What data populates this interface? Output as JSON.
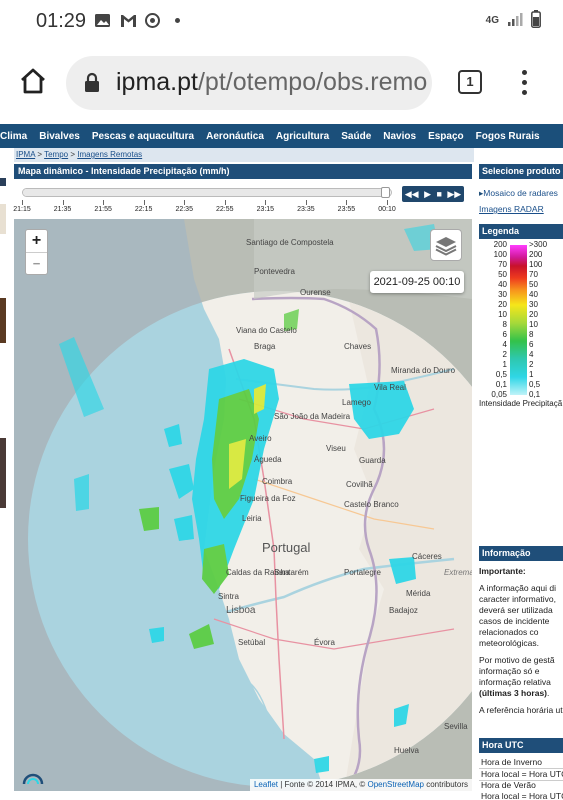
{
  "status_bar": {
    "time": "01:29",
    "network": "4G"
  },
  "browser": {
    "url_host": "ipma.pt",
    "url_path": "/pt/otempo/obs.remo",
    "tab_count": "1"
  },
  "nav": {
    "items": [
      "Clima",
      "Bivalves",
      "Pescas e aquacultura",
      "Aeronáutica",
      "Agricultura",
      "Saúde",
      "Navios",
      "Espaço",
      "Fogos Rurais"
    ]
  },
  "breadcrumb": {
    "items": [
      "IPMA",
      "Tempo",
      "Imagens Remotas"
    ],
    "sep": " > "
  },
  "panel": {
    "title": "Mapa dinâmico - Intensidade Precipitação (mm/h)"
  },
  "timeline": {
    "labels": [
      "21:15",
      "21:35",
      "21:55",
      "22:15",
      "22:35",
      "22:55",
      "23:15",
      "23:35",
      "23:55",
      "00:10"
    ],
    "progress": 1.0,
    "controls": [
      "◀◀",
      "▶",
      "■",
      "▶▶"
    ]
  },
  "map": {
    "zoom_in": "+",
    "zoom_out": "−",
    "timestamp": "2021-09-25 00:10",
    "attribution_leaflet": "Leaflet",
    "attribution_mid": " | Fonte © 2014 IPMA, © ",
    "attribution_osm": "OpenStreetMap",
    "attribution_end": " contributors",
    "places": [
      {
        "name": "Santiago de Compostela"
      },
      {
        "name": "Pontevedra"
      },
      {
        "name": "Ourense"
      },
      {
        "name": "Viana do Castelo"
      },
      {
        "name": "Braga"
      },
      {
        "name": "Chaves"
      },
      {
        "name": "Miranda do Douro"
      },
      {
        "name": "Vila Real"
      },
      {
        "name": "Lamego"
      },
      {
        "name": "São João da Madeira"
      },
      {
        "name": "Aveiro"
      },
      {
        "name": "Viseu"
      },
      {
        "name": "Guarda"
      },
      {
        "name": "Águeda"
      },
      {
        "name": "Coimbra"
      },
      {
        "name": "Covilhã"
      },
      {
        "name": "Figueira da Foz"
      },
      {
        "name": "Leiria"
      },
      {
        "name": "Castelo Branco"
      },
      {
        "name": "Portugal"
      },
      {
        "name": "Cáceres"
      },
      {
        "name": "Extremad"
      },
      {
        "name": "Caldas da Rainha"
      },
      {
        "name": "Santarém"
      },
      {
        "name": "Portalegre"
      },
      {
        "name": "Sintra"
      },
      {
        "name": "Lisboa"
      },
      {
        "name": "Mérida"
      },
      {
        "name": "Badajoz"
      },
      {
        "name": "Setúbal"
      },
      {
        "name": "Évora"
      },
      {
        "name": "Sevilla"
      },
      {
        "name": "Huelva"
      }
    ]
  },
  "sidebar": {
    "product_header": "Selecione produto r",
    "product_links": [
      "Mosaico de radares",
      "Imagens RADAR"
    ],
    "legend_header": "Legenda",
    "legend_left": [
      "200",
      "100",
      "70",
      "50",
      "40",
      "30",
      "20",
      "10",
      "8",
      "6",
      "4",
      "2",
      "1",
      "0,5",
      "0,1",
      "0,05"
    ],
    "legend_right": [
      ">300",
      "200",
      "100",
      "70",
      "50",
      "40",
      "30",
      "20",
      "10",
      "8",
      "6",
      "4",
      "2",
      "1",
      "0,5",
      "0,1"
    ],
    "legend_caption": "Intensidade Precipitaçã",
    "info_header": "Informação",
    "info_important": "Importante:",
    "info_p1": "A informação aqui di caracter informativo, deverá ser utilizada casos de incidente relacionados co meteorológicas.",
    "info_p2a": "Por motivo de gestã informação só e informação relativa",
    "info_p2b": "(últimas 3 horas)",
    "info_p2c": ".",
    "info_p3": "A referência horária uti",
    "utc_header": "Hora UTC",
    "utc_rows": [
      "Hora de Inverno",
      "Hora local = Hora UTC",
      "Hora de Verão",
      "Hora local = Hora UTC"
    ]
  },
  "colors": {
    "nav_bg": "#1b4f7a",
    "panel_header": "#1f4e79",
    "link": "#1a4f8a",
    "sea": "#cdd9df",
    "land": "#f2efe9",
    "radar_cyan": "#2fd6e6",
    "radar_green": "#5ccd44",
    "radar_yellow": "#d6e83a"
  },
  "icons": [
    "home-icon",
    "lock-icon",
    "tabs-icon",
    "kebab-menu-icon",
    "layers-icon",
    "image-icon",
    "gmail-icon",
    "sync-icon",
    "signal-icon",
    "battery-icon"
  ]
}
